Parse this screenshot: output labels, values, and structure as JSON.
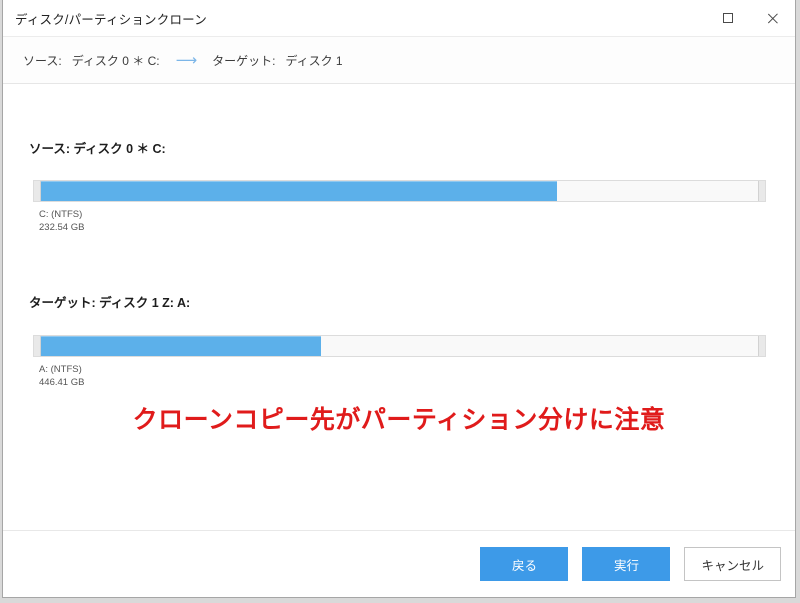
{
  "window": {
    "title": "ディスク/パーティションクローン",
    "controls": {
      "maximize": "maximize",
      "close": "close"
    }
  },
  "breadcrumb": {
    "source_label": "ソース:",
    "source_value": "ディスク 0 ＊ C:",
    "arrow": "⟶",
    "target_label": "ターゲット:",
    "target_value": "ディスク 1"
  },
  "source": {
    "heading": "ソース: ディスク 0 ＊ C:",
    "fill_percent": 72,
    "partition_name": "C: (NTFS)",
    "partition_size": "232.54 GB"
  },
  "target": {
    "heading": "ターゲット: ディスク 1 Z: A:",
    "fill_percent": 39,
    "partition_name": "A: (NTFS)",
    "partition_size": "446.41 GB"
  },
  "warning": {
    "text": "クローンコピー先がパーティション分けに注意",
    "color": "#e01b1b"
  },
  "footer": {
    "back_label": "戻る",
    "execute_label": "実行",
    "cancel_label": "キャンセル"
  },
  "colors": {
    "accent": "#3d9ae8",
    "bar_fill": "#5cb0ea",
    "arrow": "#7cb6e8"
  }
}
